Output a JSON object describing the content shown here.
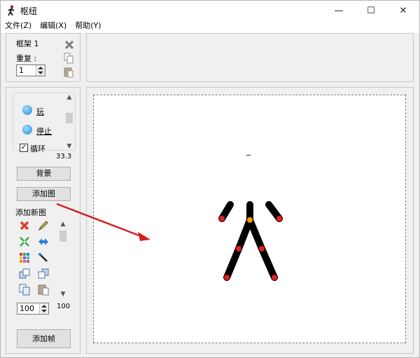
{
  "window": {
    "title": "枢纽",
    "controls": {
      "minimize": "—",
      "maximize": "☐",
      "close": "✕"
    }
  },
  "menu": [
    {
      "label": "文件(Z)"
    },
    {
      "label": "编辑(X)"
    },
    {
      "label": "帮助(Y)"
    }
  ],
  "frame_panel": {
    "frame_label": "框架 1",
    "repeat_label": "重复 :",
    "repeat_value": "1"
  },
  "playback": {
    "play_label": "玩",
    "stop_label": "停止",
    "loop_label": "循环",
    "loop_checked": true,
    "speed_value": "33.3"
  },
  "buttons": {
    "background": "背景",
    "add_figure": "添加图",
    "add_frame": "添加帧"
  },
  "new_figure": {
    "label": "添加新图",
    "size_value": "100",
    "scale_value": "100"
  },
  "icons": {
    "app": "stickman-icon",
    "delete_frame": "close-x-icon",
    "copy_frame": "copy-icon",
    "paste_frame": "paste-icon",
    "play": "play-icon",
    "stop": "stop-icon",
    "grid": [
      "delete-x-icon",
      "pencil-icon",
      "shrink-arrows-icon",
      "flip-arrows-icon",
      "color-palette-icon",
      "joint-tool-icon",
      "bring-forward-icon",
      "send-backward-icon",
      "copy-figure-icon",
      "paste-figure-icon"
    ]
  },
  "canvas": {
    "figure_label": "_",
    "figure_color": "#000000",
    "joint_color": "#e02020",
    "pivot_color": "#ff9900"
  },
  "annotation_arrow_color": "#d62020"
}
